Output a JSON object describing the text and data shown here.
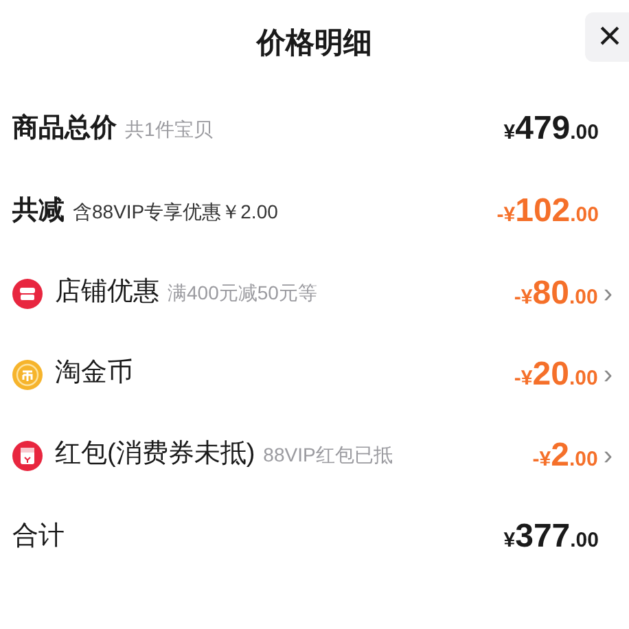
{
  "header": {
    "title": "价格明细",
    "close": "×"
  },
  "rows": [
    {
      "kind": "summary",
      "label": "商品总价",
      "note": "共1件宝贝",
      "amount": {
        "sign": "¥",
        "integer": "479",
        "decimal": ".00"
      },
      "discount": false
    },
    {
      "kind": "summary",
      "label": "共减",
      "note": "含88VIP专享优惠￥2.00",
      "amount": {
        "sign": "-¥",
        "integer": "102",
        "decimal": ".00"
      },
      "discount": true
    },
    {
      "kind": "store",
      "label": "店铺优惠",
      "note": "满400元减50元等",
      "amount": {
        "sign": "-¥",
        "integer": "80",
        "decimal": ".00"
      },
      "discount": true,
      "chevron": "›"
    },
    {
      "kind": "coin",
      "label": "淘金币",
      "amount": {
        "sign": "-¥",
        "integer": "20",
        "decimal": ".00"
      },
      "discount": true,
      "chevron": "›"
    },
    {
      "kind": "envelope",
      "label": "红包(消费券未抵)",
      "note": "88VIP红包已抵",
      "amount": {
        "sign": "-¥",
        "integer": "2",
        "decimal": ".00"
      },
      "discount": true,
      "chevron": "›"
    },
    {
      "kind": "total",
      "label": "合计",
      "amount": {
        "sign": "¥",
        "integer": "377",
        "decimal": ".00"
      },
      "discount": false
    }
  ]
}
